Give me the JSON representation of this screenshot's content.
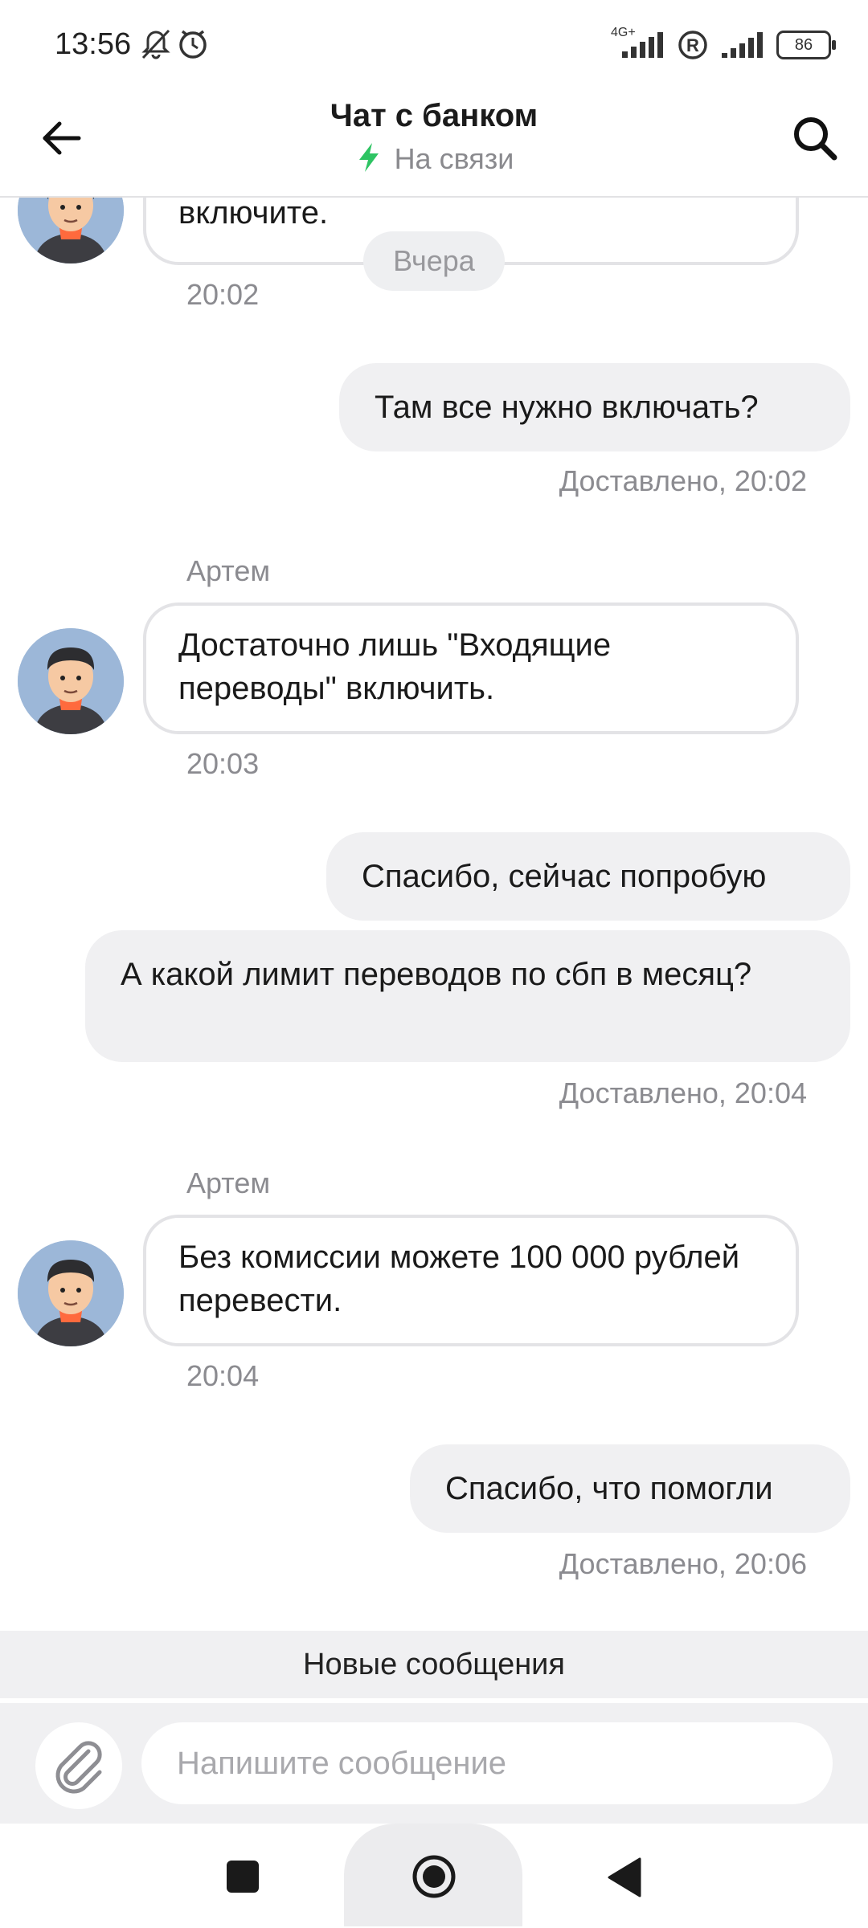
{
  "status_bar": {
    "time": "13:56",
    "network": "4G+",
    "battery": "86"
  },
  "header": {
    "title": "Чат с банком",
    "status": "На связи",
    "status_color": "#2ec463"
  },
  "chat": {
    "date_chip": "Вчера",
    "messages": [
      {
        "dir": "in",
        "text": "включите.",
        "time": "20:02"
      },
      {
        "dir": "out",
        "text": "Там все нужно включать?",
        "status": "Доставлено, 20:02"
      },
      {
        "dir": "in",
        "sender": "Артем",
        "text": "Достаточно лишь \"Входящие переводы\" включить.",
        "time": "20:03"
      },
      {
        "dir": "out",
        "text": "Спасибо, сейчас попробую"
      },
      {
        "dir": "out",
        "text": "А какой лимит переводов по сбп в месяц?",
        "status": "Доставлено, 20:04"
      },
      {
        "dir": "in",
        "sender": "Артем",
        "text": "Без комиссии можете 100 000 рублей перевести.",
        "time": "20:04"
      },
      {
        "dir": "out",
        "text": "Спасибо, что помогли",
        "status": "Доставлено, 20:06"
      }
    ]
  },
  "new_messages_label": "Новые сообщения",
  "composer": {
    "placeholder": "Напишите сообщение"
  },
  "icons": {
    "back": "arrow-left-icon",
    "search": "search-icon",
    "attach": "paperclip-icon",
    "online": "lightning-icon",
    "nav_recent": "square-icon",
    "nav_home": "circle-icon",
    "nav_back": "triangle-back-icon"
  }
}
